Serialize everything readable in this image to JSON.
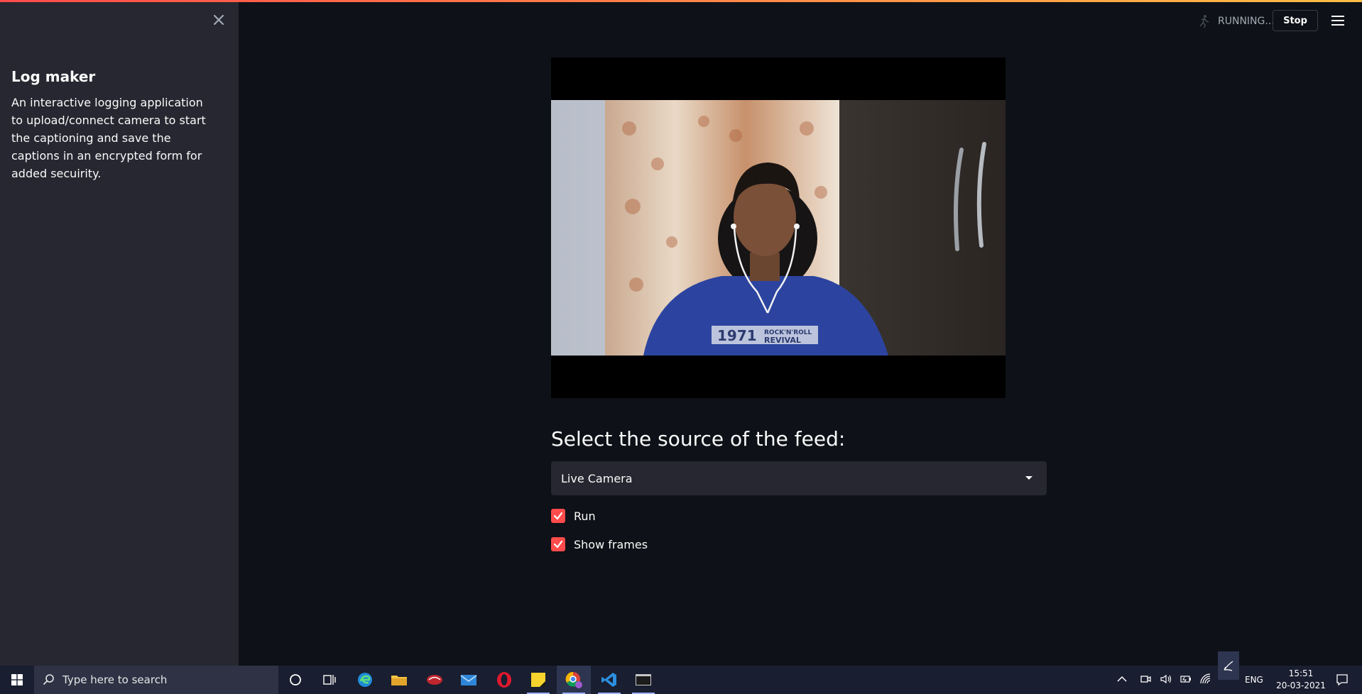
{
  "sidebar": {
    "title": "Log maker",
    "description": "An interactive logging application to upload/connect camera to start the captioning and save the captions in an encrypted form for added secuirity."
  },
  "header": {
    "status_text": "RUNNING...",
    "stop_label": "Stop"
  },
  "main": {
    "select_label": "Select the source of the feed:",
    "select_value": "Live Camera",
    "checkboxes": [
      {
        "label": "Run",
        "checked": true
      },
      {
        "label": "Show frames",
        "checked": true
      }
    ],
    "video_shirt_text_1": "1971",
    "video_shirt_text_2": "ROCK'N'ROLL",
    "video_shirt_text_3": "REVIVAL"
  },
  "taskbar": {
    "search_placeholder": "Type here to search",
    "language": "ENG",
    "time": "15:51",
    "date": "20-03-2021"
  },
  "colors": {
    "accent": "#ff4b4b",
    "sidebar_bg": "#262730",
    "main_bg": "#0e1117",
    "taskbar_bg": "#191e30"
  }
}
